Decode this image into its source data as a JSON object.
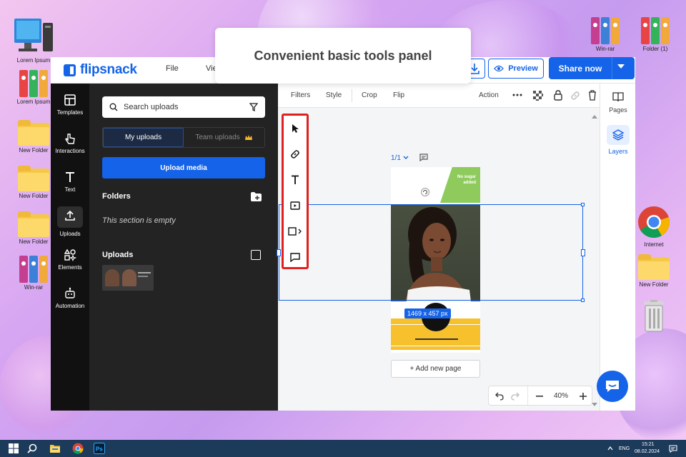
{
  "desktop": {
    "icons_left": [
      {
        "label": "Lorem Ipsum",
        "kind": "computer"
      },
      {
        "label": "Lorem Ipsum",
        "kind": "binders"
      },
      {
        "label": "New Folder",
        "kind": "folder"
      },
      {
        "label": "New Folder",
        "kind": "folder"
      },
      {
        "label": "New Folder",
        "kind": "folder"
      },
      {
        "label": "Win-rar",
        "kind": "winrar"
      }
    ],
    "icons_right": [
      {
        "label": "Win-rar",
        "kind": "winrar"
      },
      {
        "label": "Folder (1)",
        "kind": "binders"
      },
      {
        "label": "Internet",
        "kind": "chrome"
      },
      {
        "label": "New Folder",
        "kind": "folder"
      },
      {
        "label": "",
        "kind": "recycle-bin"
      }
    ]
  },
  "callout": {
    "text": "Convenient basic tools panel"
  },
  "app": {
    "logo_text": "flipsnack",
    "menu": [
      "File",
      "Vie"
    ],
    "preview_label": "Preview",
    "share_label": "Share now",
    "left_nav": [
      {
        "label": "Templates",
        "icon": "templates-icon"
      },
      {
        "label": "Interactions",
        "icon": "interactions-icon"
      },
      {
        "label": "Text",
        "icon": "text-icon"
      },
      {
        "label": "Uploads",
        "icon": "upload-icon",
        "active": true
      },
      {
        "label": "Elements",
        "icon": "elements-icon"
      },
      {
        "label": "Automation",
        "icon": "automation-icon"
      }
    ],
    "panel": {
      "search_placeholder": "Search uploads",
      "tab_my": "My uploads",
      "tab_team": "Team uploads",
      "upload_button": "Upload media",
      "folders_title": "Folders",
      "folders_empty": "This section is empty",
      "uploads_title": "Uploads"
    },
    "toolbar": {
      "filters": "Filters",
      "style": "Style",
      "crop": "Crop",
      "flip": "Flip",
      "action": "Action"
    },
    "tools": [
      "select-tool",
      "link-tool",
      "text-tool",
      "media-tool",
      "shape-tool",
      "comment-tool"
    ],
    "canvas": {
      "page_indicator": "1/1",
      "badge_text": "No sugar added",
      "selection_size": "1469 x 457 px",
      "add_page": "+ Add new page",
      "zoom": "40%"
    },
    "right_bar": [
      {
        "label": "Pages",
        "icon": "pages-icon"
      },
      {
        "label": "Layers",
        "icon": "layers-icon",
        "active": true
      }
    ]
  },
  "taskbar": {
    "lang": "ENG",
    "time": "15:21",
    "date": "08.02.2024"
  },
  "colors": {
    "brand": "#1463e8",
    "highlight": "#e02020",
    "panel_bg": "#232323",
    "nav_bg": "#111111"
  }
}
